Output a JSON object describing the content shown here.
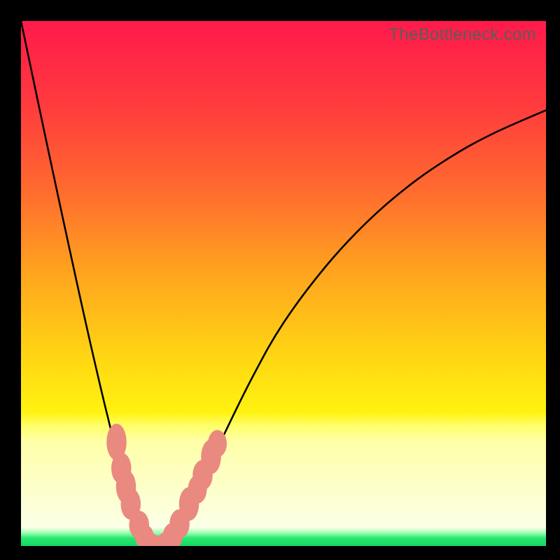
{
  "watermark": "TheBottleneck.com",
  "chart_data": {
    "type": "line",
    "title": "",
    "xlabel": "",
    "ylabel": "",
    "xlim": [
      0,
      100
    ],
    "ylim": [
      0,
      100
    ],
    "gradient_stops": [
      {
        "offset": 0.0,
        "color": "#ff1a4b"
      },
      {
        "offset": 0.16,
        "color": "#ff3b3d"
      },
      {
        "offset": 0.32,
        "color": "#ff6a2f"
      },
      {
        "offset": 0.48,
        "color": "#ffa41e"
      },
      {
        "offset": 0.64,
        "color": "#ffd613"
      },
      {
        "offset": 0.745,
        "color": "#fff210"
      },
      {
        "offset": 0.77,
        "color": "#ffff66"
      },
      {
        "offset": 0.8,
        "color": "#ffffa8"
      },
      {
        "offset": 0.965,
        "color": "#fbffe6"
      },
      {
        "offset": 0.975,
        "color": "#9cffb2"
      },
      {
        "offset": 0.985,
        "color": "#28e86f"
      },
      {
        "offset": 1.0,
        "color": "#16d862"
      }
    ],
    "series": [
      {
        "name": "bottleneck-curve",
        "x": [
          0.0,
          2.0,
          4.0,
          6.0,
          8.0,
          10.0,
          12.0,
          14.0,
          16.0,
          18.0,
          19.0,
          20.0,
          21.0,
          22.0,
          23.0,
          24.0,
          26.0,
          28.0,
          30.0,
          34.0,
          38.0,
          44.0,
          50.0,
          58.0,
          66.0,
          74.0,
          82.0,
          90.0,
          100.0
        ],
        "values": [
          100.0,
          90.5,
          81.0,
          71.6,
          62.3,
          53.1,
          44.0,
          35.2,
          26.7,
          18.6,
          14.8,
          11.3,
          8.0,
          5.1,
          2.7,
          1.0,
          0.05,
          1.0,
          3.5,
          11.0,
          19.8,
          32.0,
          42.5,
          53.2,
          61.8,
          68.7,
          74.2,
          78.6,
          83.0
        ]
      }
    ],
    "markers": {
      "name": "highlight-dots",
      "color": "#e98980",
      "points": [
        {
          "x": 18.2,
          "y": 19.8,
          "rx": 1.9,
          "ry": 3.5
        },
        {
          "x": 19.1,
          "y": 14.8,
          "rx": 1.9,
          "ry": 3.0
        },
        {
          "x": 20.0,
          "y": 11.3,
          "rx": 1.9,
          "ry": 3.2
        },
        {
          "x": 20.9,
          "y": 8.0,
          "rx": 1.9,
          "ry": 3.0
        },
        {
          "x": 22.5,
          "y": 4.0,
          "rx": 1.9,
          "ry": 2.7
        },
        {
          "x": 23.5,
          "y": 1.8,
          "rx": 1.8,
          "ry": 2.3
        },
        {
          "x": 24.7,
          "y": 0.55,
          "rx": 1.8,
          "ry": 1.9
        },
        {
          "x": 26.1,
          "y": 0.05,
          "rx": 1.9,
          "ry": 1.9
        },
        {
          "x": 27.6,
          "y": 0.6,
          "rx": 1.8,
          "ry": 2.0
        },
        {
          "x": 28.9,
          "y": 1.9,
          "rx": 1.9,
          "ry": 2.5
        },
        {
          "x": 30.2,
          "y": 4.2,
          "rx": 1.9,
          "ry": 2.8
        },
        {
          "x": 32.0,
          "y": 8.0,
          "rx": 1.9,
          "ry": 3.2
        },
        {
          "x": 33.6,
          "y": 10.8,
          "rx": 1.8,
          "ry": 2.7
        },
        {
          "x": 34.6,
          "y": 13.5,
          "rx": 1.9,
          "ry": 2.9
        },
        {
          "x": 36.2,
          "y": 17.0,
          "rx": 1.9,
          "ry": 3.3
        },
        {
          "x": 37.4,
          "y": 19.5,
          "rx": 1.8,
          "ry": 2.6
        }
      ]
    }
  }
}
